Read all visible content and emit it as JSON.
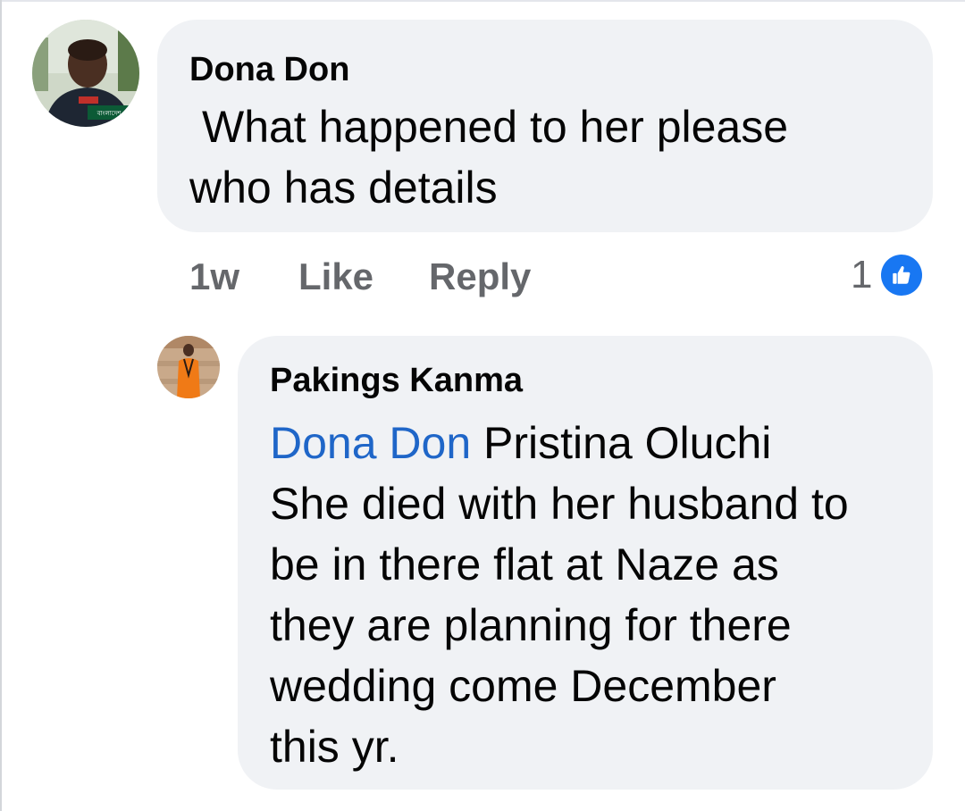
{
  "comments": [
    {
      "author": "Dona Don",
      "lines": [
        "What happened to her please",
        "who has details"
      ],
      "time": "1w",
      "like_label": "Like",
      "reply_label": "Reply",
      "reaction_count": "1",
      "avatar_caption": "বাংলাদেশ"
    },
    {
      "author": "Pakings Kanma",
      "mention": "Dona Don",
      "first_line_rest": " Pristina Oluchi",
      "lines": [
        "She died with her husband to",
        "be in there flat at Naze as",
        "they are planning for there",
        "wedding come December",
        "this yr."
      ]
    }
  ],
  "colors": {
    "bubble": "#f0f2f5",
    "mention": "#1f66c8",
    "like_blue": "#1877f2",
    "meta_gray": "#65676b"
  },
  "icons": {
    "reaction": "thumbs-up-icon"
  }
}
